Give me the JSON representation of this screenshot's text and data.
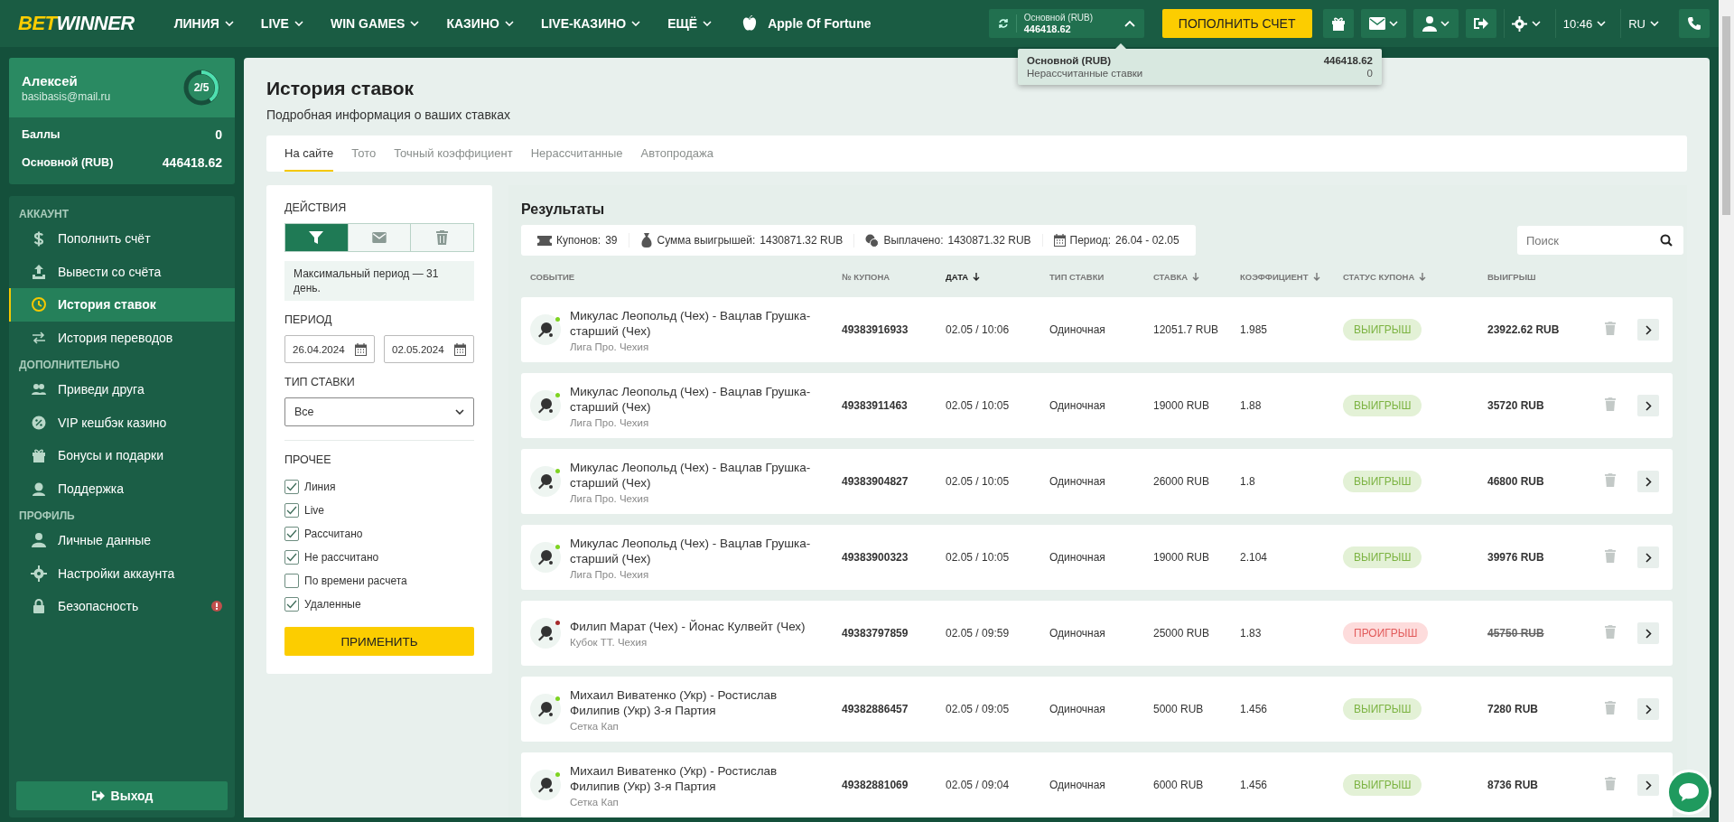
{
  "header": {
    "logo": [
      "BET",
      "WINNER"
    ],
    "nav": [
      "ЛИНИЯ",
      "LIVE",
      "WIN GAMES",
      "КАЗИНО",
      "LIVE-КАЗИНО",
      "ЕЩЁ"
    ],
    "promo": "Apple Of Fortune",
    "balance": {
      "label": "Основной (RUB)",
      "amount": "446418.62",
      "expanded": true
    },
    "deposit_button": "ПОПОЛНИТЬ СЧЕТ",
    "time": "10:46",
    "language": "RU"
  },
  "balance_popup": [
    {
      "label": "Основной (RUB)",
      "value": "446418.62"
    },
    {
      "label": "Нерассчитанные ставки",
      "value": "0"
    }
  ],
  "sidebar": {
    "profile": {
      "name": "Алексей",
      "email": "basibasis@mail.ru",
      "progress": "2/5",
      "level": 0.4,
      "stats": [
        {
          "label": "Баллы",
          "value": "0"
        },
        {
          "label": "Основной (RUB)",
          "value": "446418.62"
        }
      ]
    },
    "sections": [
      {
        "title": "АККАУНТ",
        "items": [
          {
            "label": "Пополнить счёт",
            "selected": false,
            "alert": false
          },
          {
            "label": "Вывести со счёта",
            "selected": false,
            "alert": false
          },
          {
            "label": "История ставок",
            "selected": true,
            "alert": false
          },
          {
            "label": "История переводов",
            "selected": false,
            "alert": false
          }
        ]
      },
      {
        "title": "ДОПОЛНИТЕЛЬНО",
        "items": [
          {
            "label": "Приведи друга",
            "selected": false,
            "alert": false
          },
          {
            "label": "VIP кешбэк казино",
            "selected": false,
            "alert": false
          },
          {
            "label": "Бонусы и подарки",
            "selected": false,
            "alert": false
          },
          {
            "label": "Поддержка",
            "selected": false,
            "alert": false
          }
        ]
      },
      {
        "title": "ПРОФИЛЬ",
        "items": [
          {
            "label": "Личные данные",
            "selected": false,
            "alert": false
          },
          {
            "label": "Настройки аккаунта",
            "selected": false,
            "alert": false
          },
          {
            "label": "Безопасность",
            "selected": false,
            "alert": true
          }
        ]
      }
    ],
    "logout": "Выход"
  },
  "page": {
    "title": "История ставок",
    "subtitle": "Подробная информация о ваших ставках",
    "tabs": [
      {
        "label": "На сайте",
        "selected": true
      },
      {
        "label": "Тото",
        "selected": false
      },
      {
        "label": "Точный коэффициент",
        "selected": false
      },
      {
        "label": "Нерассчитанные",
        "selected": false
      },
      {
        "label": "Автопродажа",
        "selected": false
      }
    ]
  },
  "filters": {
    "actions_title": "ДЕЙСТВИЯ",
    "actions": [
      {
        "kind": "filter",
        "selected": true
      },
      {
        "kind": "mail",
        "selected": false
      },
      {
        "kind": "delete",
        "selected": false
      }
    ],
    "note": "Максимальный период — 31 день.",
    "period_title": "ПЕРИОД",
    "date_from": "26.04.2024",
    "date_to": "02.05.2024",
    "type_title": "ТИП СТАВКИ",
    "type_value": "Все",
    "other_title": "ПРОЧЕЕ",
    "options": [
      {
        "label": "Линия",
        "checked": true
      },
      {
        "label": "Live",
        "checked": true
      },
      {
        "label": "Рассчитано",
        "checked": true
      },
      {
        "label": "Не рассчитано",
        "checked": true
      },
      {
        "label": "По времени расчета",
        "checked": false
      },
      {
        "label": "Удаленные",
        "checked": true
      }
    ],
    "apply": "ПРИМЕНИТЬ"
  },
  "results": {
    "title": "Результаты",
    "summary": [
      {
        "label": "Купонов:",
        "value": "39"
      },
      {
        "label": "Сумма выигрышей:",
        "value": "1430871.32 RUB"
      },
      {
        "label": "Выплачено:",
        "value": "1430871.32 RUB"
      },
      {
        "label": "Период:",
        "value": "26.04 - 02.05"
      }
    ],
    "search": {
      "placeholder": "Поиск"
    },
    "columns": [
      {
        "label": "СОБЫТИЕ",
        "sortable": false,
        "selected": false
      },
      {
        "label": "№ КУПОНА",
        "sortable": false,
        "selected": false
      },
      {
        "label": "ДАТА",
        "sortable": true,
        "selected": true
      },
      {
        "label": "ТИП СТАВКИ",
        "sortable": false,
        "selected": false
      },
      {
        "label": "СТАВКА",
        "sortable": true,
        "selected": false
      },
      {
        "label": "КОЭФФИЦИЕНТ",
        "sortable": true,
        "selected": false
      },
      {
        "label": "СТАТУС КУПОНА",
        "sortable": true,
        "selected": false
      },
      {
        "label": "ВЫИГРЫШ",
        "sortable": false,
        "selected": false
      }
    ],
    "rows": [
      {
        "event": "Микулас Леопольд (Чех) - Вацлав Грушка-старший (Чех)",
        "league": "Лига Про. Чехия",
        "color": "#7ed321",
        "coupon": "49383916933",
        "date": "02.05 / 10:06",
        "type": "Одиночная",
        "stake": "12051.7 RUB",
        "coef": "1.985",
        "kind": "win",
        "status": "ВЫИГРЫШ",
        "payout": "23922.62 RUB"
      },
      {
        "event": "Микулас Леопольд (Чех) - Вацлав Грушка-старший (Чех)",
        "league": "Лига Про. Чехия",
        "color": "#7ed321",
        "coupon": "49383911463",
        "date": "02.05 / 10:05",
        "type": "Одиночная",
        "stake": "19000 RUB",
        "coef": "1.88",
        "kind": "win",
        "status": "ВЫИГРЫШ",
        "payout": "35720 RUB"
      },
      {
        "event": "Микулас Леопольд (Чех) - Вацлав Грушка-старший (Чех)",
        "league": "Лига Про. Чехия",
        "color": "#7ed321",
        "coupon": "49383904827",
        "date": "02.05 / 10:05",
        "type": "Одиночная",
        "stake": "26000 RUB",
        "coef": "1.8",
        "kind": "win",
        "status": "ВЫИГРЫШ",
        "payout": "46800 RUB"
      },
      {
        "event": "Микулас Леопольд (Чех) - Вацлав Грушка-старший (Чех)",
        "league": "Лига Про. Чехия",
        "color": "#7ed321",
        "coupon": "49383900323",
        "date": "02.05 / 10:05",
        "type": "Одиночная",
        "stake": "19000 RUB",
        "coef": "2.104",
        "kind": "win",
        "status": "ВЫИГРЫШ",
        "payout": "39976 RUB"
      },
      {
        "event": "Филип Марат (Чех) - Йонас Кулвейт (Чех)",
        "league": "Кубок ТТ. Чехия",
        "color": "#a52a2a",
        "coupon": "49383797859",
        "date": "02.05 / 09:59",
        "type": "Одиночная",
        "stake": "25000 RUB",
        "coef": "1.83",
        "kind": "loss",
        "status": "ПРОИГРЫШ",
        "payout": "45750 RUB"
      },
      {
        "event": "Михаил Виватенко (Укр) - Ростислав Филипив (Укр) 3-я Партия",
        "league": "Сетка Кап",
        "color": "#7ed321",
        "coupon": "49382886457",
        "date": "02.05 / 09:05",
        "type": "Одиночная",
        "stake": "5000 RUB",
        "coef": "1.456",
        "kind": "win",
        "status": "ВЫИГРЫШ",
        "payout": "7280 RUB"
      },
      {
        "event": "Михаил Виватенко (Укр) - Ростислав Филипив (Укр) 3-я Партия",
        "league": "Сетка Кап",
        "color": "#7ed321",
        "coupon": "49382881069",
        "date": "02.05 / 09:04",
        "type": "Одиночная",
        "stake": "6000 RUB",
        "coef": "1.456",
        "kind": "win",
        "status": "ВЫИГРЫШ",
        "payout": "8736 RUB"
      }
    ]
  }
}
